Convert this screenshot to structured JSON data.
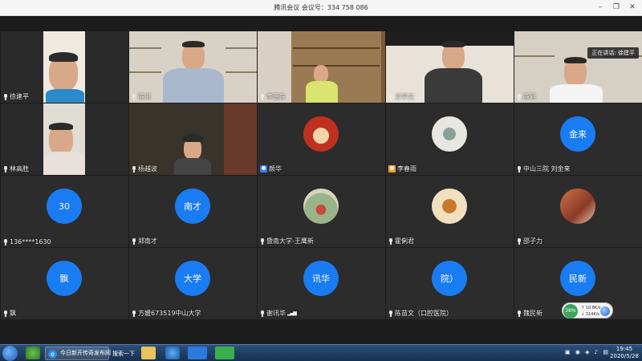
{
  "window": {
    "title": "腾讯会议  会议号：334 758 086",
    "controls": {
      "minimize": "–",
      "restore": "❐",
      "close": "✕"
    }
  },
  "speaking_badge": "正在讲话: 徐建平",
  "participants": [
    {
      "name": "徐建平",
      "type": "video"
    },
    {
      "name": "陈洪",
      "type": "video"
    },
    {
      "name": "李惠东",
      "type": "video"
    },
    {
      "name": "方学文",
      "type": "video"
    },
    {
      "name": "陈延",
      "type": "video"
    },
    {
      "name": "林高胜",
      "type": "video"
    },
    {
      "name": "杨越波",
      "type": "video"
    },
    {
      "name": "颜华",
      "type": "photo"
    },
    {
      "name": "李春雨",
      "type": "photo"
    },
    {
      "name": "中山三院 刘金来",
      "type": "avatar",
      "avatar_text": "金来"
    },
    {
      "name": "136****1630",
      "type": "avatar",
      "avatar_text": "30"
    },
    {
      "name": "郑南才",
      "type": "avatar",
      "avatar_text": "南才"
    },
    {
      "name": "暨南大学-王鹰新",
      "type": "photo"
    },
    {
      "name": "霍俐君",
      "type": "photo"
    },
    {
      "name": "邵子力",
      "type": "photo"
    },
    {
      "name": "飘",
      "type": "avatar",
      "avatar_text": "飘"
    },
    {
      "name": "方媛673519中山大学",
      "type": "avatar",
      "avatar_text": "大学"
    },
    {
      "name": "谢讯华",
      "type": "avatar",
      "avatar_text": "讯华"
    },
    {
      "name": "陈苗文（口腔医院）",
      "type": "avatar",
      "avatar_text": "院）"
    },
    {
      "name": "魏民新",
      "type": "avatar",
      "avatar_text": "民新"
    }
  ],
  "network": {
    "percent": "28%",
    "up": "10.8K/s",
    "down": "314K/s"
  },
  "taskbar": {
    "browser_item": "今日新开传奇发布网",
    "search_link": "搜索一下",
    "time": "19:45",
    "date": "2020/5/28"
  },
  "colors": {
    "avatar_blue": "#1a7cf2",
    "active_border": "#4fa34f",
    "tile_bg": "#2c2c2c"
  }
}
